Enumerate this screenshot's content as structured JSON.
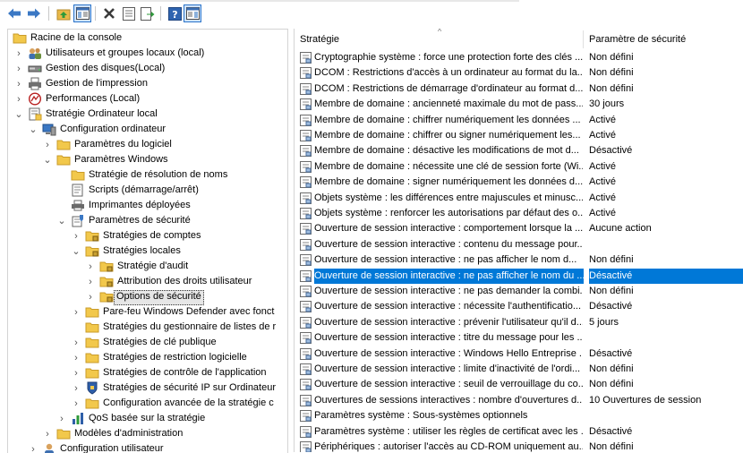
{
  "toolbar": {
    "buttons": [
      {
        "name": "back-icon"
      },
      {
        "name": "forward-icon"
      },
      {
        "name": "up-folder-icon"
      },
      {
        "name": "show-hide-tree-icon"
      },
      {
        "name": "delete-icon"
      },
      {
        "name": "properties-icon"
      },
      {
        "name": "export-list-icon"
      },
      {
        "name": "help-icon"
      },
      {
        "name": "show-action-pane-icon"
      }
    ]
  },
  "tree": {
    "items": [
      {
        "label": "Racine de la console"
      },
      {
        "label": "Utilisateurs et groupes locaux (local)"
      },
      {
        "label": "Gestion des disques(Local)"
      },
      {
        "label": "Gestion de l'impression"
      },
      {
        "label": "Performances (Local)"
      },
      {
        "label": "Stratégie Ordinateur local"
      },
      {
        "label": "Configuration ordinateur"
      },
      {
        "label": "Paramètres du logiciel"
      },
      {
        "label": "Paramètres Windows"
      },
      {
        "label": "Stratégie de résolution de noms"
      },
      {
        "label": "Scripts (démarrage/arrêt)"
      },
      {
        "label": "Imprimantes déployées"
      },
      {
        "label": "Paramètres de sécurité"
      },
      {
        "label": "Stratégies de comptes"
      },
      {
        "label": "Stratégies locales"
      },
      {
        "label": "Stratégie d'audit"
      },
      {
        "label": "Attribution des droits utilisateur"
      },
      {
        "label": "Options de sécurité"
      },
      {
        "label": "Pare-feu Windows Defender avec fonct"
      },
      {
        "label": "Stratégies du gestionnaire de listes de r"
      },
      {
        "label": "Stratégies de clé publique"
      },
      {
        "label": "Stratégies de restriction logicielle"
      },
      {
        "label": "Stratégies de contrôle de l'application"
      },
      {
        "label": "Stratégies de sécurité IP sur Ordinateur"
      },
      {
        "label": "Configuration avancée de la stratégie c"
      },
      {
        "label": "QoS basée sur la stratégie"
      },
      {
        "label": "Modèles d'administration"
      },
      {
        "label": "Configuration utilisateur"
      }
    ]
  },
  "list": {
    "columns": {
      "policy": "Stratégie",
      "setting": "Paramètre de sécurité"
    },
    "rows": [
      {
        "name": "Cryptographie système : force une protection forte des clés ...",
        "value": "Non défini"
      },
      {
        "name": "DCOM : Restrictions d'accès à un ordinateur au format du la...",
        "value": "Non défini"
      },
      {
        "name": "DCOM : Restrictions de démarrage d'ordinateur au format d...",
        "value": "Non défini"
      },
      {
        "name": "Membre de domaine : ancienneté maximale du mot de pass...",
        "value": "30 jours"
      },
      {
        "name": "Membre de domaine : chiffrer numériquement les données ...",
        "value": "Activé"
      },
      {
        "name": "Membre de domaine : chiffrer ou signer numériquement les...",
        "value": "Activé"
      },
      {
        "name": "Membre de domaine : désactive les modifications de mot d...",
        "value": "Désactivé"
      },
      {
        "name": "Membre de domaine : nécessite une clé de session forte (Wi...",
        "value": "Activé"
      },
      {
        "name": "Membre de domaine : signer numériquement les données d...",
        "value": "Activé"
      },
      {
        "name": "Objets système : les différences entre majuscules et minusc...",
        "value": "Activé"
      },
      {
        "name": "Objets système : renforcer les autorisations par défaut des o...",
        "value": "Activé"
      },
      {
        "name": "Ouverture de session interactive : comportement lorsque la ...",
        "value": "Aucune action"
      },
      {
        "name": "Ouverture de session interactive : contenu du message pour...",
        "value": ""
      },
      {
        "name": "Ouverture de session interactive : ne pas afficher le nom d...",
        "value": "Non défini"
      },
      {
        "name": "Ouverture de session interactive : ne pas afficher le nom du ...",
        "value": "Désactivé"
      },
      {
        "name": "Ouverture de session interactive : ne pas demander la combi...",
        "value": "Non défini"
      },
      {
        "name": "Ouverture de session interactive : nécessite l'authentificatio...",
        "value": "Désactivé"
      },
      {
        "name": "Ouverture de session interactive : prévenir l'utilisateur qu'il d...",
        "value": "5 jours"
      },
      {
        "name": "Ouverture de session interactive : titre du message pour les ...",
        "value": ""
      },
      {
        "name": "Ouverture de session interactive : Windows Hello Entreprise ...",
        "value": "Désactivé"
      },
      {
        "name": "Ouverture de session interactive : limite d'inactivité de l'ordi...",
        "value": "Non défini"
      },
      {
        "name": "Ouverture de session interactive : seuil de verrouillage du co...",
        "value": "Non défini"
      },
      {
        "name": "Ouvertures de sessions interactives : nombre d'ouvertures d...",
        "value": "10 Ouvertures de session"
      },
      {
        "name": "Paramètres système : Sous-systèmes optionnels",
        "value": ""
      },
      {
        "name": "Paramètres système : utiliser les règles de certificat avec les ...",
        "value": "Désactivé"
      },
      {
        "name": "Périphériques : autoriser l'accès au CD-ROM uniquement au...",
        "value": "Non défini"
      }
    ]
  },
  "colors": {
    "selection": "#0078d7",
    "folder": "#f2c84b",
    "accent": "#2a73c9"
  }
}
